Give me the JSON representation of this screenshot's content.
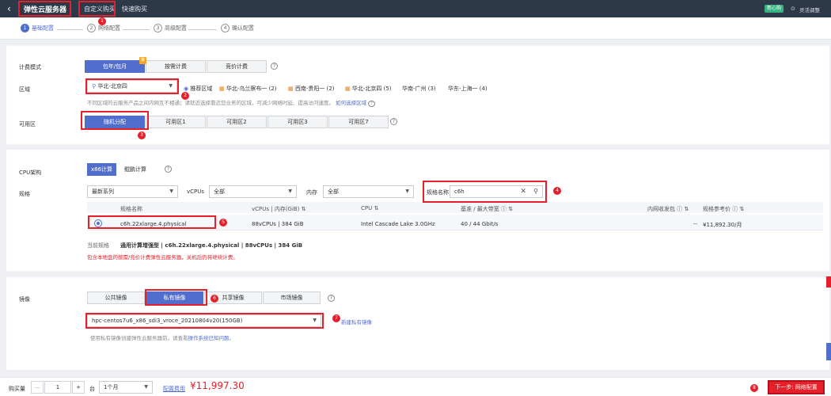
{
  "header": {
    "back_icon": "chevron-left-icon",
    "title": "弹性云服务器",
    "tab_custom": "自定义购买",
    "tab_quick": "快速购买",
    "new_badge": "新心购",
    "right_link": "灵活调整",
    "check_icon": "check-circle-icon"
  },
  "wizard": [
    {
      "num": "1",
      "label": "基础配置",
      "active": true
    },
    {
      "num": "2",
      "label": "网络配置"
    },
    {
      "num": "3",
      "label": "高级配置"
    },
    {
      "num": "4",
      "label": "确认配置"
    }
  ],
  "billing": {
    "label": "计费模式",
    "options": [
      "包年/包月",
      "按需计费",
      "竞价计费"
    ],
    "selected": "包年/包月",
    "tag": "推"
  },
  "region": {
    "label": "区域",
    "selected": "华北-北京四",
    "recommend": "推荐区域",
    "zones": [
      "华北-乌兰察布一 (2)",
      "西南-贵阳一 (2)",
      "华北-北京四 (5)",
      "华南-广州 (3)",
      "华东-上海一 (4)"
    ],
    "note": "不同区域的云服务产品之间内网互不相通；请就近选择靠近您业务的区域，可减少网络时延、提高访问速度。",
    "note_link": "如何选择区域"
  },
  "az": {
    "label": "可用区",
    "options": [
      "随机分配",
      "可用区1",
      "可用区2",
      "可用区3",
      "可用区7"
    ],
    "selected": "随机分配"
  },
  "cpu": {
    "label": "CPU架构",
    "options": [
      "x86计算",
      "鲲鹏计算"
    ],
    "selected": "x86计算"
  },
  "spec": {
    "label": "规格",
    "series": "最新系列",
    "vcpus_label": "vCPUs",
    "vcpus_value": "全部",
    "mem_label": "内存",
    "mem_value": "全部",
    "name_label": "规格名称",
    "name_value": "c6h",
    "clear_icon": "close-icon",
    "search_icon": "search-icon"
  },
  "table": {
    "headers": [
      "规格名称",
      "vCPUs | 内存(GiB)",
      "CPU",
      "基准 / 最大带宽",
      "内网收发包",
      "规格参考价"
    ],
    "row": {
      "name": "c6h.22xlarge.4.physical",
      "vcpus_mem": "88vCPUs | 384 GiB",
      "cpu": "Intel Cascade Lake 3.0GHz",
      "bandwidth": "40 / 44 Gbit/s",
      "pps": "--",
      "price": "¥11,892.30/月"
    }
  },
  "current": {
    "label": "当前规格",
    "value": "通用计算增强型 | c6h.22xlarge.4.physical | 88vCPUs | 384 GiB",
    "warn": "包含本地盘的按需/竞价计费弹性云服务器，关机后仍将继续计费。"
  },
  "image": {
    "label": "镜像",
    "options": [
      "公共镜像",
      "私有镜像",
      "共享镜像",
      "市场镜像"
    ],
    "selected": "私有镜像",
    "value": "hpc-centos7u6_x86_sdi3_vroce_20210804v20(150GB)",
    "create": "新建私有镜像",
    "note_a": "使用私有镜像创建弹性云服务器前，请查看",
    "note_link": "操作系统已知问题",
    "note_b": "。"
  },
  "footer": {
    "qty_label": "购买量",
    "qty": "1",
    "minus": "—",
    "plus": "+",
    "for": "台",
    "duration": "1个月",
    "fee_label": "配置费用",
    "fee": "¥11,997.30",
    "next": "下一步: 网络配置"
  },
  "markers": [
    "1",
    "2",
    "3",
    "4",
    "5",
    "6",
    "7",
    "8"
  ],
  "colors": {
    "accent": "#526ecc",
    "marker": "#e5202b",
    "header": "#2d3848"
  }
}
